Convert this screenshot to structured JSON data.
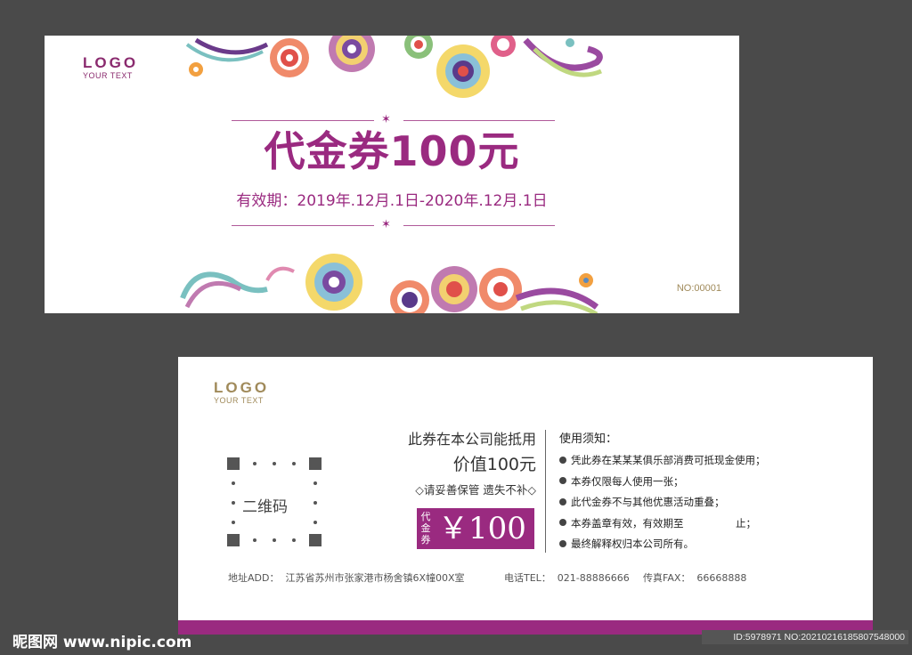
{
  "front": {
    "logo": "LOGO",
    "logo_sub": "YOUR TEXT",
    "title": "代金券100元",
    "validity": "有效期：2019年.12月.1日-2020年.12月.1日",
    "number": "NO:00001",
    "star_glyph": "✶"
  },
  "back": {
    "logo": "LOGO",
    "logo_sub": "YOUR TEXT",
    "qr_label": "二维码",
    "line1": "此券在本公司能抵用",
    "line2": "价值100元",
    "notice": "◇请妥善保管 遗失不补◇",
    "stamp_small": "代金券",
    "stamp_big": "￥100",
    "rules_title": "使用须知：",
    "rules": [
      "凭此券在某某某俱乐部消费可抵现金使用；",
      "本券仅限每人使用一张；",
      "此代金券不与其他优惠活动重叠；",
      "本券盖章有效，有效期至                止；",
      "最终解释权归本公司所有。"
    ],
    "address": "地址ADD：  江苏省苏州市张家港市杨舍镇6X幢00X室",
    "phone": "电话TEL：  021-88886666",
    "fax": "传真FAX：  66668888"
  },
  "watermark": {
    "site": "昵图网 www.nipic.com",
    "id": "ID:5978971 NO:20210216185807548000"
  },
  "colors": {
    "brand_purple": "#9a2a80",
    "gold": "#a08a5a",
    "background": "#4a4a4a"
  }
}
